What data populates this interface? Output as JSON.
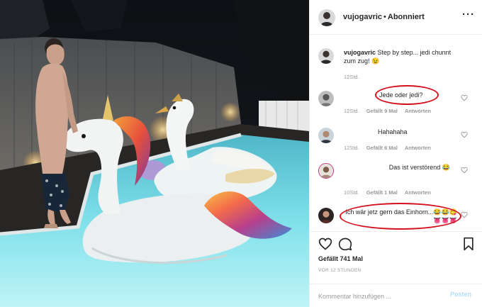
{
  "post": {
    "username": "vujogavric",
    "separator": "•",
    "follow_status": "Abonniert",
    "more_label": "···"
  },
  "caption": {
    "username": "vujogavric",
    "text": "Step by step... jedi chunnt zum zug! 😉",
    "time": "12Std."
  },
  "comments": [
    {
      "text": "Jede oder jedi?",
      "time": "12Std.",
      "likes": "Gefällt 9 Mal",
      "reply": "Antworten"
    },
    {
      "text": "Hahahaha",
      "time": "12Std.",
      "likes": "Gefällt 6 Mal",
      "reply": "Antworten"
    },
    {
      "text": "Das ist verstörend 😂",
      "time": "10Std.",
      "likes": "Gefällt 1 Mal",
      "reply": "Antworten"
    },
    {
      "text": "Ich wär jetz gern das Einhorn...😂😂😋👅👅👅"
    }
  ],
  "actions": {
    "likes": "Gefällt 741 Mal",
    "time": "VOR 12 STUNDEN"
  },
  "add_comment": {
    "placeholder": "Kommentar hinzufügen ...",
    "post_label": "Posten"
  },
  "colors": {
    "highlight": "#d4101c",
    "text": "#262626",
    "muted": "#999999",
    "post_button": "#b2dffc"
  },
  "icons": [
    "heart-icon",
    "comment-icon",
    "bookmark-icon",
    "more-icon"
  ]
}
